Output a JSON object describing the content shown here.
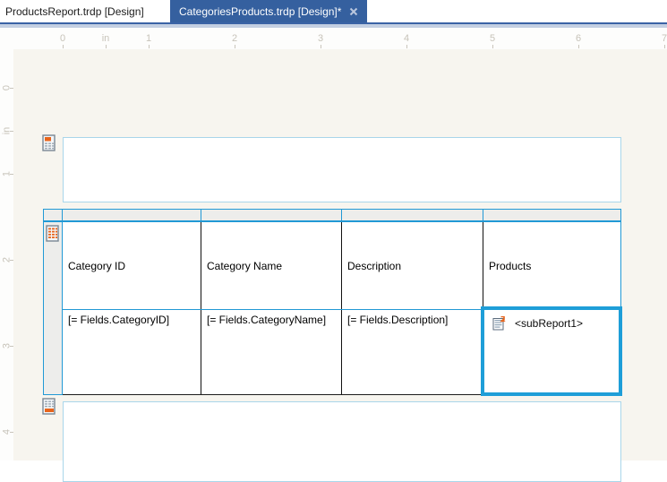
{
  "tabs": {
    "inactive": {
      "label": "ProductsReport.trdp [Design]"
    },
    "active": {
      "label": "CategoriesProducts.trdp [Design]*"
    }
  },
  "ruler": {
    "unit": "in",
    "horizontal": [
      "0",
      "in",
      "1",
      "2",
      "3",
      "4",
      "5",
      "6",
      "7"
    ],
    "vertical": [
      "0",
      "in",
      "1",
      "2",
      "3",
      "4"
    ]
  },
  "design": {
    "sections": [
      "page-header",
      "detail",
      "page-footer"
    ],
    "table": {
      "header_cells": [
        "Category ID",
        "Category Name",
        "Description",
        "Products"
      ],
      "data_cells": [
        "[= Fields.CategoryID]",
        "[= Fields.CategoryName]",
        "[= Fields.Description]"
      ],
      "subreport_label": "<subReport1>"
    }
  },
  "icons": [
    "page-header-icon",
    "detail-section-icon",
    "page-footer-icon",
    "subreport-icon",
    "close-icon"
  ],
  "colors": {
    "tab_active_bg": "#35609f",
    "tab_strip": "#c3cfe2",
    "selection_blue": "#1e9ed8",
    "grid_blue": "#2199d5",
    "section_border": "#a9d6ea",
    "canvas_bg": "#f7f5ef",
    "cell_border": "#111111",
    "accent_orange": "#e8641b"
  }
}
